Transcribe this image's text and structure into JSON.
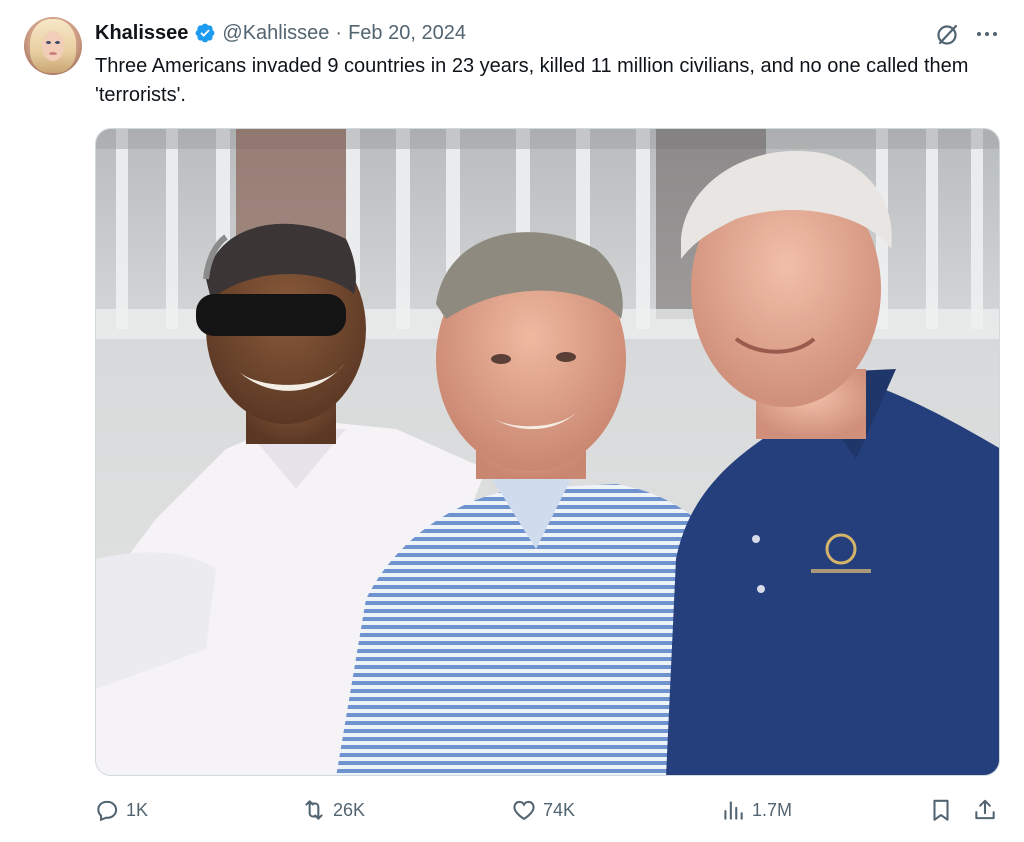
{
  "author": {
    "name": "Khalissee",
    "handle": "@Kahlissee",
    "separator": "·",
    "date": "Feb 20, 2024",
    "verified": true,
    "verified_color": "#1d9bf0"
  },
  "tweet": {
    "text": "Three Americans invaded 9 countries in 23 years, killed 11 million civilians, and no one called them 'terrorists'."
  },
  "media": {
    "description_type": "photo"
  },
  "actions": {
    "reply_count": "1K",
    "retweet_count": "26K",
    "like_count": "74K",
    "views_count": "1.7M"
  },
  "icons": {
    "header": [
      "grok-icon",
      "more-icon"
    ],
    "actions": [
      "reply-icon",
      "retweet-icon",
      "like-icon",
      "views-icon",
      "bookmark-icon",
      "share-icon"
    ]
  },
  "colors": {
    "text": "#0f1419",
    "secondary": "#536471",
    "border": "#cfd9de"
  }
}
